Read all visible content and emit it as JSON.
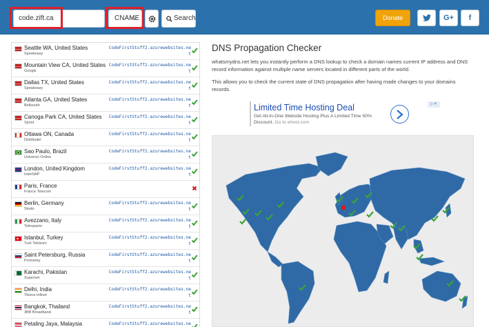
{
  "header": {
    "domain_value": "code.zift.ca",
    "record_type": "CNAME",
    "search_label": "Search",
    "donate_label": "Donate",
    "social": [
      {
        "name": "twitter",
        "glyph": "t"
      },
      {
        "name": "google-plus",
        "glyph": "G+"
      },
      {
        "name": "facebook",
        "glyph": "f"
      }
    ]
  },
  "servers": [
    {
      "location": "Seattle WA, United States",
      "provider": "Speakeasy",
      "flag": "us",
      "result": "CodeFirstStuff2.azurewebsites.net",
      "status": "ok"
    },
    {
      "location": "Mountain View CA, United States",
      "provider": "Google",
      "flag": "us",
      "result": "CodeFirstStuff2.azurewebsites.net",
      "status": "ok"
    },
    {
      "location": "Dallas TX, United States",
      "provider": "Speakeasy",
      "flag": "us",
      "result": "CodeFirstStuff2.azurewebsites.net",
      "status": "ok"
    },
    {
      "location": "Atlanta GA, United States",
      "provider": "Bellsouth",
      "flag": "us",
      "result": "CodeFirstStuff2.azurewebsites.net",
      "status": "ok"
    },
    {
      "location": "Canoga Park CA, United States",
      "provider": "Sprint",
      "flag": "us",
      "result": "CodeFirstStuff2.azurewebsites.net",
      "status": "ok"
    },
    {
      "location": "Ottawa ON, Canada",
      "provider": "Distributel",
      "flag": "ca",
      "result": "CodeFirstStuff2.azurewebsites.net",
      "status": "ok"
    },
    {
      "location": "Sao Paulo, Brazil",
      "provider": "Universo Online",
      "flag": "br",
      "result": "CodeFirstStuff2.azurewebsites.net",
      "status": "ok"
    },
    {
      "location": "London, United Kingdom",
      "provider": "InterNAP",
      "flag": "gb",
      "result": "CodeFirstStuff2.azurewebsites.net",
      "status": "ok"
    },
    {
      "location": "Paris, France",
      "provider": "France Telecom",
      "flag": "fr",
      "result": "",
      "status": "fail"
    },
    {
      "location": "Berlin, Germany",
      "provider": "Strato",
      "flag": "de",
      "result": "CodeFirstStuff2.azurewebsites.net",
      "status": "ok"
    },
    {
      "location": "Avezzano, Italy",
      "provider": "Telespazio",
      "flag": "it",
      "result": "CodeFirstStuff2.azurewebsites.net",
      "status": "ok"
    },
    {
      "location": "Istanbul, Turkey",
      "provider": "Turk Telekom",
      "flag": "tr",
      "result": "CodeFirstStuff2.azurewebsites.net",
      "status": "ok"
    },
    {
      "location": "Saint Petersburg, Russia",
      "provider": "Prometey",
      "flag": "ru",
      "result": "CodeFirstStuff2.azurewebsites.net",
      "status": "ok"
    },
    {
      "location": "Karachi, Pakistan",
      "provider": "Supernet",
      "flag": "pk",
      "result": "CodeFirstStuff2.azurewebsites.net",
      "status": "ok"
    },
    {
      "location": "Delhi, India",
      "provider": "Tikona Infinet",
      "flag": "in",
      "result": "CodeFirstStuff2.azurewebsites.net",
      "status": "ok"
    },
    {
      "location": "Bangkok, Thailand",
      "provider": "3BB Broadband",
      "flag": "th",
      "result": "CodeFirstStuff2.azurewebsites.net",
      "status": "ok"
    },
    {
      "location": "Petaling Jaya, Malaysia",
      "provider": "",
      "flag": "my",
      "result": "CodeFirstStuff2.azurewebsites.net",
      "status": "ok"
    }
  ],
  "main": {
    "title": "DNS Propagation Checker",
    "desc1": "whatsmydns.net lets you instantly perform a DNS lookup to check a domain names current IP address and DNS record information against multiple name servers located in different parts of the world.",
    "desc2": "This allows you to check the current state of DNS propagation after having made changes to your domains records."
  },
  "ad": {
    "title": "Limited Time Hosting Deal",
    "text": "Get All-In-One Website Hosting Plus A Limited Time 50% Discount.",
    "url": "Go to ehost.com",
    "badge": "▷✕"
  },
  "colors": {
    "header": "#2b72ad",
    "donate": "#f0a30a",
    "map_land": "#2f6aa6",
    "ok": "#3aa33a",
    "fail": "#d22020",
    "result_link": "#1c58a6"
  },
  "map_markers": [
    {
      "status": "ok"
    },
    {
      "status": "ok"
    },
    {
      "status": "ok"
    },
    {
      "status": "ok"
    },
    {
      "status": "ok"
    },
    {
      "status": "ok"
    },
    {
      "status": "ok"
    },
    {
      "status": "ok"
    },
    {
      "status": "fail"
    },
    {
      "status": "ok"
    },
    {
      "status": "ok"
    },
    {
      "status": "ok"
    },
    {
      "status": "ok"
    },
    {
      "status": "ok"
    },
    {
      "status": "ok"
    },
    {
      "status": "ok"
    },
    {
      "status": "ok"
    },
    {
      "status": "ok"
    },
    {
      "status": "ok"
    },
    {
      "status": "ok"
    },
    {
      "status": "ok"
    }
  ]
}
